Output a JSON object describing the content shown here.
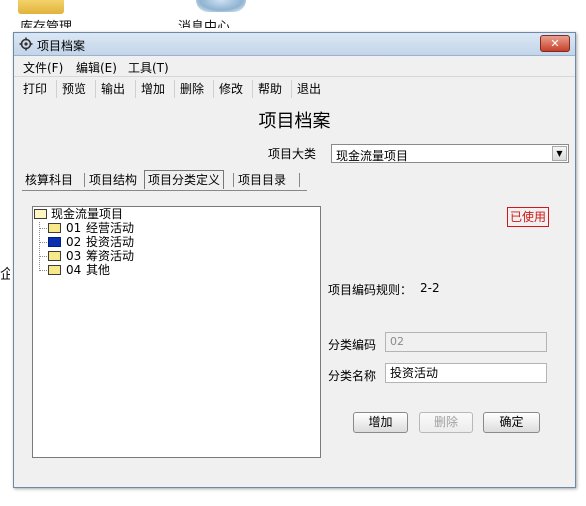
{
  "desktop": {
    "icon1_label": "库存管理",
    "icon2_label": "消息中心",
    "edge_char": "企"
  },
  "window": {
    "title": "项目档案",
    "close_glyph": "✕"
  },
  "menu": [
    "文件(F)",
    "编辑(E)",
    "工具(T)"
  ],
  "toolbar": [
    "打印",
    "预览",
    "输出",
    "增加",
    "删除",
    "修改",
    "帮助",
    "退出"
  ],
  "heading": "项目档案",
  "category": {
    "label": "项目大类",
    "value": "现金流量项目"
  },
  "tabs": [
    "核算科目",
    "项目结构",
    "项目分类定义",
    "项目目录"
  ],
  "active_tab_index": 2,
  "tree": {
    "root": "现金流量项目",
    "children": [
      {
        "code": "01",
        "name": "经营活动",
        "selected": false
      },
      {
        "code": "02",
        "name": "投资活动",
        "selected": true
      },
      {
        "code": "03",
        "name": "筹资活动",
        "selected": false
      },
      {
        "code": "04",
        "name": "其他",
        "selected": false
      }
    ]
  },
  "status_badge": "已使用",
  "rule": {
    "label": "项目编码规则：",
    "value": "2-2"
  },
  "form": {
    "code_label": "分类编码",
    "code_value": "02",
    "name_label": "分类名称",
    "name_value": "投资活动"
  },
  "buttons": {
    "add": "增加",
    "delete": "删除",
    "confirm": "确定"
  },
  "colors": {
    "badge": "#d01818",
    "selected_folder": "#0b2fb3",
    "close_button": "#c8412b"
  }
}
